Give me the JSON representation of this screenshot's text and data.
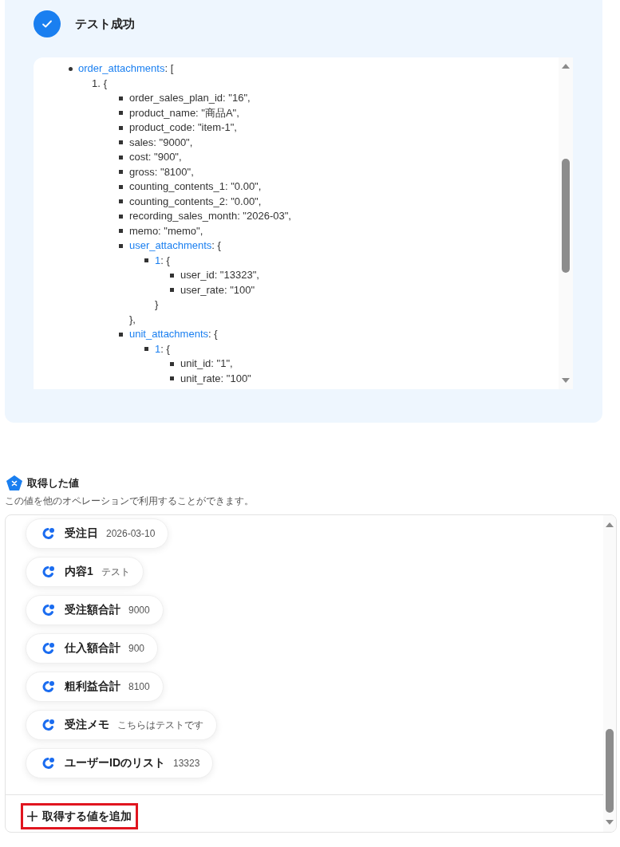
{
  "result": {
    "title": "テスト成功",
    "tree": [
      {
        "kind": "disc",
        "key": "order_attachments",
        "rest": ": [",
        "children": [
          {
            "kind": "numbered",
            "number": "1.",
            "text": "{",
            "children": [
              {
                "kind": "square",
                "text": "order_sales_plan_id: \"16\","
              },
              {
                "kind": "square",
                "text": "product_name: \"商品A\","
              },
              {
                "kind": "square",
                "text": "product_code: \"item-1\","
              },
              {
                "kind": "square",
                "text": "sales: \"9000\","
              },
              {
                "kind": "square",
                "text": "cost: \"900\","
              },
              {
                "kind": "square",
                "text": "gross: \"8100\","
              },
              {
                "kind": "square",
                "text": "counting_contents_1: \"0.00\","
              },
              {
                "kind": "square",
                "text": "counting_contents_2: \"0.00\","
              },
              {
                "kind": "square",
                "text": "recording_sales_month: \"2026-03\","
              },
              {
                "kind": "square",
                "text": "memo: \"memo\","
              },
              {
                "kind": "square",
                "key": "user_attachments",
                "rest": ": {",
                "close": "},",
                "children": [
                  {
                    "kind": "square",
                    "key": "1",
                    "rest": ": {",
                    "close": "}",
                    "children": [
                      {
                        "kind": "square",
                        "text": "user_id: \"13323\","
                      },
                      {
                        "kind": "square",
                        "text": "user_rate: \"100\""
                      }
                    ]
                  }
                ]
              },
              {
                "kind": "square",
                "key": "unit_attachments",
                "rest": ": {",
                "children": [
                  {
                    "kind": "square",
                    "key": "1",
                    "rest": ": {",
                    "children": [
                      {
                        "kind": "square",
                        "text": "unit_id: \"1\","
                      },
                      {
                        "kind": "square",
                        "text": "unit_rate: \"100\""
                      }
                    ]
                  }
                ]
              }
            ]
          }
        ]
      }
    ]
  },
  "values": {
    "title": "取得した値",
    "description": "この値を他のオペレーションで利用することができます。",
    "items": [
      {
        "label": "受注日",
        "value": "2026-03-10"
      },
      {
        "label": "内容1",
        "value": "テスト"
      },
      {
        "label": "受注額合計",
        "value": "9000"
      },
      {
        "label": "仕入額合計",
        "value": "900"
      },
      {
        "label": "粗利益合計",
        "value": "8100"
      },
      {
        "label": "受注メモ",
        "value": "こちらはテストです"
      },
      {
        "label": "ユーザーIDのリスト",
        "value": "13323"
      }
    ],
    "add_button": "取得する値を追加"
  }
}
